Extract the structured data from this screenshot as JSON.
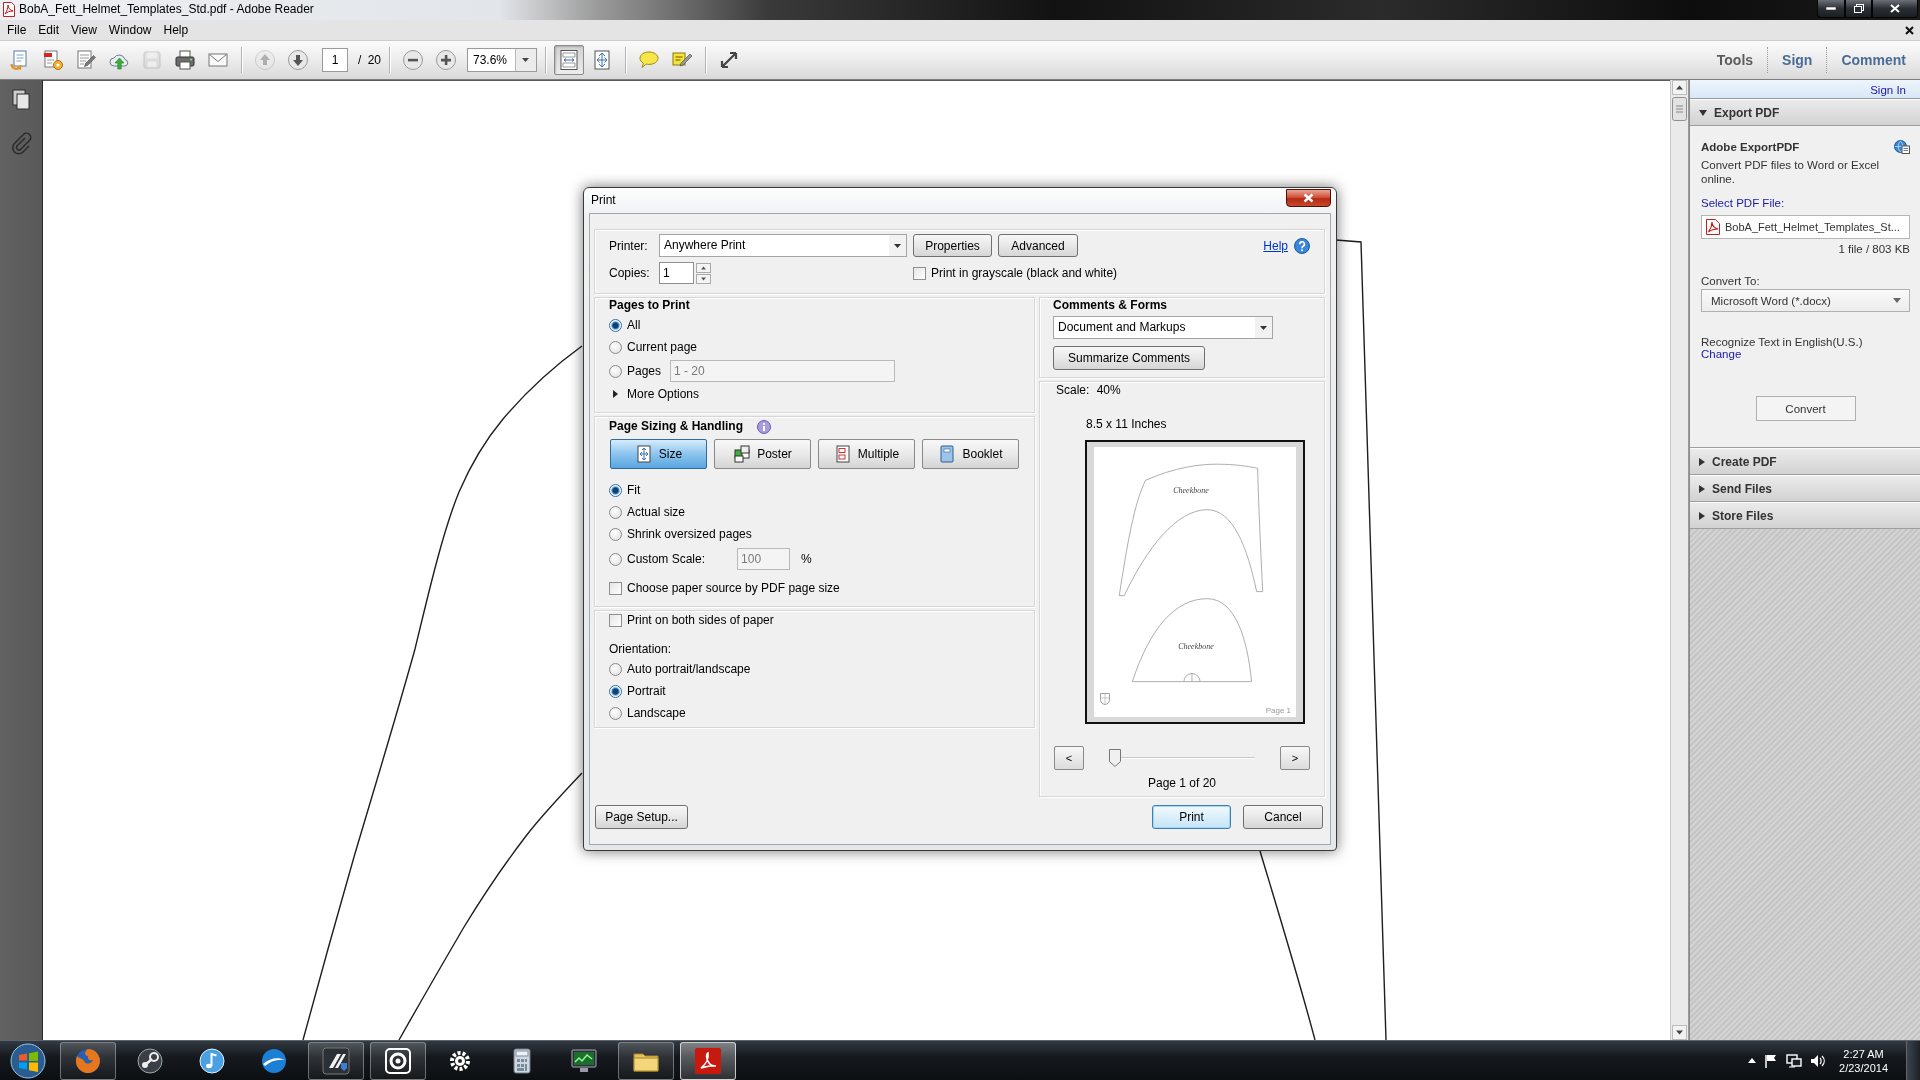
{
  "window": {
    "title": "BobA_Fett_Helmet_Templates_Std.pdf - Adobe Reader"
  },
  "menu": [
    {
      "label": "File"
    },
    {
      "label": "Edit"
    },
    {
      "label": "View"
    },
    {
      "label": "Window"
    },
    {
      "label": "Help"
    }
  ],
  "toolbar": {
    "groups": [
      {
        "buttons": [
          {
            "kind": "create",
            "disabled": false,
            "pressed": false
          },
          {
            "kind": "convert",
            "disabled": false,
            "pressed": false
          },
          {
            "kind": "edit",
            "disabled": false,
            "pressed": false
          },
          {
            "kind": "upload",
            "disabled": false,
            "pressed": false
          },
          {
            "kind": "save",
            "disabled": true,
            "pressed": false
          },
          {
            "kind": "print",
            "disabled": false,
            "pressed": false
          },
          {
            "kind": "email",
            "disabled": false,
            "pressed": false
          }
        ]
      },
      {
        "buttons": [
          {
            "kind": "prev-page",
            "disabled": true,
            "pressed": false
          },
          {
            "kind": "next-page",
            "disabled": false,
            "pressed": false
          }
        ],
        "page_field": "1",
        "page_total": "/ 20"
      },
      {
        "buttons": [
          {
            "kind": "zoom-out",
            "disabled": false,
            "pressed": false
          },
          {
            "kind": "zoom-in",
            "disabled": false,
            "pressed": false
          }
        ],
        "zoom_field": "73.6%"
      },
      {
        "buttons": [
          {
            "kind": "fit-page",
            "disabled": false,
            "pressed": true
          },
          {
            "kind": "fit-width",
            "disabled": false,
            "pressed": false
          }
        ]
      },
      {
        "buttons": [
          {
            "kind": "comment",
            "disabled": false,
            "pressed": false
          },
          {
            "kind": "highlight",
            "disabled": false,
            "pressed": false
          }
        ]
      },
      {
        "buttons": [
          {
            "kind": "full-screen",
            "disabled": false,
            "pressed": false
          }
        ]
      }
    ],
    "task_buttons": [
      {
        "label": "Tools",
        "color": "#5c5c5c"
      },
      {
        "label": "Sign",
        "color": "#4a6b95"
      },
      {
        "label": "Comment",
        "color": "#4a6b95"
      }
    ]
  },
  "nav_pane": {
    "buttons": [
      {
        "kind": "pages"
      },
      {
        "kind": "attachments"
      }
    ]
  },
  "print_dialog": {
    "title": "Print",
    "printer": {
      "label": "Printer:",
      "value": "Anywhere Print"
    },
    "printer_buttons": [
      {
        "label": "Properties"
      },
      {
        "label": "Advanced"
      }
    ],
    "help": "Help",
    "copies": {
      "label": "Copies:",
      "value": "1"
    },
    "grayscale": {
      "label": "Print in grayscale (black and white)",
      "checked": false
    },
    "pages_to_print": {
      "title": "Pages to Print",
      "options": [
        {
          "label": "All",
          "selected": true
        },
        {
          "label": "Current page",
          "selected": false
        },
        {
          "label": "Pages",
          "selected": false,
          "field": {
            "value": "1 - 20",
            "disabled": true
          }
        }
      ],
      "more_options": "More Options"
    },
    "sizing": {
      "title": "Page Sizing & Handling",
      "modes": [
        {
          "kind": "size",
          "label": "Size",
          "selected": true
        },
        {
          "kind": "poster",
          "label": "Poster",
          "selected": false
        },
        {
          "kind": "multiple",
          "label": "Multiple",
          "selected": false
        },
        {
          "kind": "booklet",
          "label": "Booklet",
          "selected": false
        }
      ],
      "options": [
        {
          "label": "Fit",
          "selected": true
        },
        {
          "label": "Actual size",
          "selected": false
        },
        {
          "label": "Shrink oversized pages",
          "selected": false
        },
        {
          "label": "Custom Scale:",
          "selected": false,
          "field": {
            "value": "100",
            "disabled": true
          },
          "unit": "%"
        }
      ],
      "paper_source": {
        "label": "Choose paper source by PDF page size",
        "checked": false
      }
    },
    "duplex": {
      "label": "Print on both sides of paper",
      "checked": false
    },
    "orientation": {
      "title": "Orientation:",
      "options": [
        {
          "label": "Auto portrait/landscape",
          "selected": false
        },
        {
          "label": "Portrait",
          "selected": true
        },
        {
          "label": "Landscape",
          "selected": false
        }
      ]
    },
    "comments_forms": {
      "title": "Comments & Forms",
      "value": "Document and Markups",
      "button": "Summarize Comments"
    },
    "preview": {
      "scale": "Scale: 40%",
      "paper_size": "8.5 x 11 Inches",
      "page_labels": [
        "Cheekbone",
        "Cheekbone"
      ],
      "page_footer": "Page 1",
      "prev": "<",
      "next": ">",
      "level": 0,
      "status": "Page 1 of 20"
    },
    "page_setup": "Page Setup...",
    "actions": [
      {
        "label": "Print",
        "default": true
      },
      {
        "label": "Cancel",
        "default": false
      }
    ]
  },
  "side_panel": {
    "sign_in": "Sign In",
    "sections": [
      {
        "title": "Export PDF",
        "expanded": true,
        "content": {
          "heading": "Adobe ExportPDF",
          "description": "Convert PDF files to Word or Excel online.",
          "select_label": "Select PDF File:",
          "file": "BobA_Fett_Helmet_Templates_St...",
          "file_info": "1 file / 803 KB",
          "convert_label": "Convert To:",
          "format": "Microsoft Word (*.docx)",
          "ocr_text": "Recognize Text in English(U.S.)",
          "ocr_link": "Change",
          "button": "Convert"
        }
      },
      {
        "title": "Create PDF",
        "expanded": false
      },
      {
        "title": "Send Files",
        "expanded": false
      },
      {
        "title": "Store Files",
        "expanded": false
      }
    ]
  },
  "taskbar": {
    "apps": [
      {
        "kind": "globe",
        "running": true,
        "selected": false
      },
      {
        "kind": "piston",
        "running": false,
        "selected": false
      },
      {
        "kind": "note",
        "running": false,
        "selected": false
      },
      {
        "kind": "swoosh",
        "running": false,
        "selected": false
      },
      {
        "kind": "bars",
        "running": true,
        "selected": false
      },
      {
        "kind": "ring",
        "running": true,
        "selected": false
      },
      {
        "kind": "cog",
        "running": false,
        "selected": false
      },
      {
        "kind": "calculator",
        "running": false,
        "selected": false
      },
      {
        "kind": "monitor",
        "running": false,
        "selected": false
      },
      {
        "kind": "folder",
        "running": true,
        "selected": false
      },
      {
        "kind": "swirl",
        "running": true,
        "selected": true
      }
    ],
    "time": "2:27 AM",
    "date": "2/23/2014"
  }
}
